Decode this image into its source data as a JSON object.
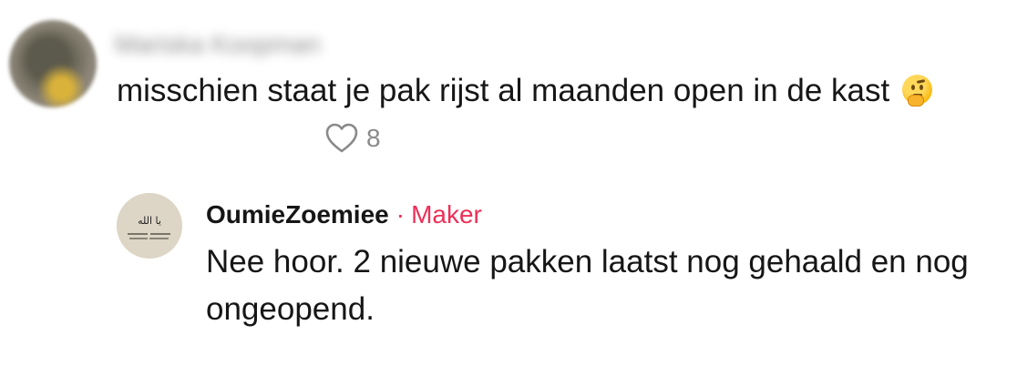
{
  "comment": {
    "author_blurred": "Mariska Koopman",
    "text": "misschien staat je pak rijst al maanden open in de kast",
    "emoji": "thinking-face",
    "likes": "8"
  },
  "reply": {
    "username": "OumieZoemiee",
    "separator": "·",
    "badge": "Maker",
    "text": "Nee hoor. 2 nieuwe pakken laatst nog gehaald en nog ongeopend.",
    "avatar_caption": "يا الله"
  },
  "colors": {
    "text": "#161616",
    "muted": "#8a8a8a",
    "maker_badge": "#ee2f57"
  }
}
